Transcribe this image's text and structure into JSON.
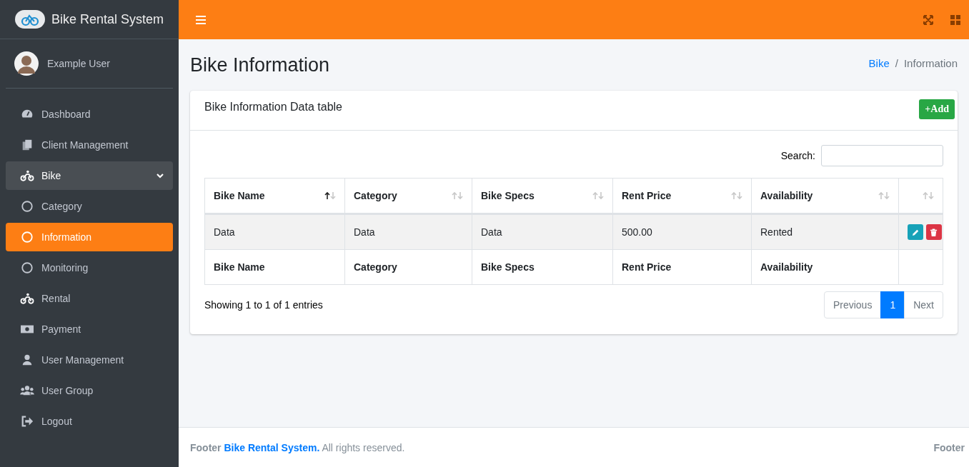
{
  "brand": {
    "title": "Bike Rental System"
  },
  "user": {
    "name": "Example User"
  },
  "sidebar": {
    "items": [
      {
        "label": "Dashboard",
        "kind": "gauge",
        "selected": false
      },
      {
        "label": "Client Management",
        "kind": "copy",
        "selected": false
      },
      {
        "label": "Bike",
        "kind": "bike",
        "selected": false,
        "expanded": true,
        "children": [
          {
            "label": "Category",
            "kind": "circle",
            "selected": false
          },
          {
            "label": "Information",
            "kind": "circle",
            "selected": true
          },
          {
            "label": "Monitoring",
            "kind": "circle",
            "selected": false
          }
        ]
      },
      {
        "label": "Rental",
        "kind": "bike",
        "selected": false
      },
      {
        "label": "Payment",
        "kind": "money",
        "selected": false
      },
      {
        "label": "User Management",
        "kind": "user",
        "selected": false
      },
      {
        "label": "User Group",
        "kind": "users",
        "selected": false
      },
      {
        "label": "Logout",
        "kind": "logout",
        "selected": false
      }
    ]
  },
  "page": {
    "title": "Bike Information",
    "breadcrumb": {
      "separator": "/",
      "items": [
        {
          "label": "Bike",
          "link": true
        },
        {
          "label": "Information",
          "link": false
        }
      ]
    }
  },
  "card": {
    "title": "Bike Information Data table",
    "add_button": "+Add",
    "search_label": "Search:",
    "table": {
      "columns": [
        {
          "label": "Bike Name",
          "sorted": true
        },
        {
          "label": "Category",
          "sorted": false
        },
        {
          "label": "Bike Specs",
          "sorted": false
        },
        {
          "label": "Rent Price",
          "sorted": false
        },
        {
          "label": "Availability",
          "sorted": false
        },
        {
          "sorted": false
        }
      ],
      "rows": [
        {
          "cells": [
            "Data",
            "Data",
            "Data",
            "500.00",
            "Rented"
          ]
        }
      ],
      "footer": [
        "Bike Name",
        "Category",
        "Bike Specs",
        "Rent Price",
        "Availability"
      ]
    },
    "info": "Showing 1 to 1 of 1 entries",
    "pagination": [
      {
        "label": "Previous",
        "selected": false
      },
      {
        "label": "1",
        "selected": true
      },
      {
        "label": "Next",
        "selected": false
      }
    ]
  },
  "footer": {
    "lead": "Footer",
    "link": "Bike Rental System.",
    "rest": "All rights reserved.",
    "right": "Footer"
  }
}
